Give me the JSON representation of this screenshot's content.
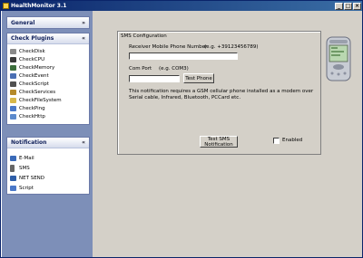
{
  "window": {
    "title": "HealthMonitor 3.1",
    "minimize": "_",
    "maximize": "□",
    "close": "×"
  },
  "sidebar": {
    "general": {
      "title": "General",
      "chevron": "»"
    },
    "plugins": {
      "title": "Check Plugins",
      "chevron": "«",
      "items": [
        {
          "label": "CheckDisk",
          "color": "#8a8a8a"
        },
        {
          "label": "CheckCPU",
          "color": "#3a3a3a"
        },
        {
          "label": "CheckMemory",
          "color": "#3c6e3c"
        },
        {
          "label": "CheckEvent",
          "color": "#4a6fb3"
        },
        {
          "label": "CheckScript",
          "color": "#505050"
        },
        {
          "label": "CheckServices",
          "color": "#b58a2a"
        },
        {
          "label": "CheckFileSystem",
          "color": "#d8b84a"
        },
        {
          "label": "CheckPing",
          "color": "#4a78c8"
        },
        {
          "label": "CheckHttp",
          "color": "#5c8acc"
        }
      ]
    },
    "notification": {
      "title": "Notification",
      "chevron": "«",
      "items": [
        {
          "label": "E-Mail",
          "color": "#3a6ab8"
        },
        {
          "label": "SMS",
          "color": "#666666"
        },
        {
          "label": "NET SEND",
          "color": "#2f5fa8"
        },
        {
          "label": "Script",
          "color": "#4a78c8"
        }
      ]
    }
  },
  "sms": {
    "group_title": "SMS Configuration",
    "phone_label": "Receiver Mobile Phone Number",
    "phone_example": "(e.g. +39123456789)",
    "phone_value": "",
    "port_label": "Com Port",
    "port_example": "(e.g. COM3)",
    "port_value": "",
    "test_phone": "Test Phone",
    "note": "This notification requires a GSM cellular phone installed as a modem over Serial cable, Infrared, Bluetooth, PCCard etc.",
    "test_sms": "Test SMS Notification",
    "enabled_label": "Enabled",
    "enabled": false
  }
}
